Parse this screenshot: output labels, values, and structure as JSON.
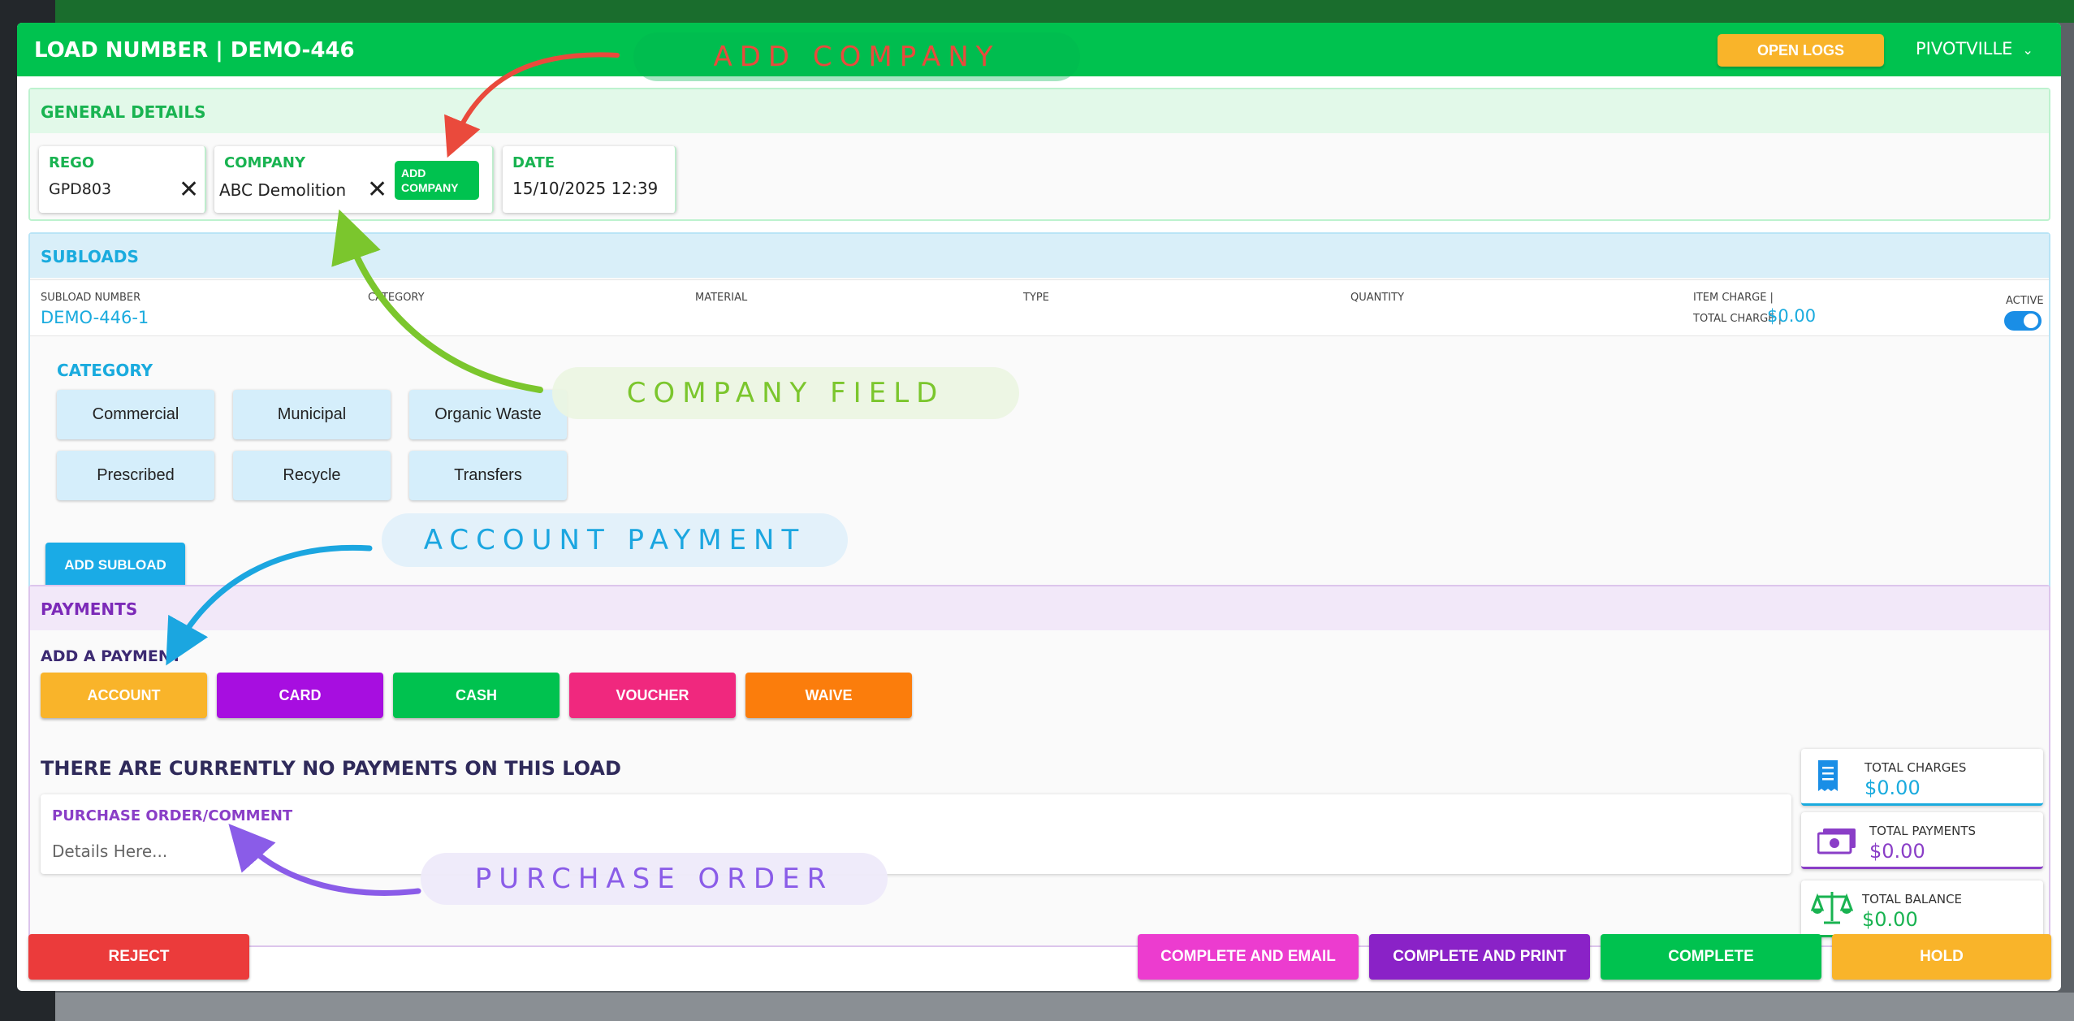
{
  "modal": {
    "title": "LOAD NUMBER | DEMO-446",
    "open_logs_label": "OPEN LOGS",
    "site_name": "PIVOTVILLE"
  },
  "general": {
    "title": "GENERAL DETAILS",
    "rego_label": "REGO",
    "rego_value": "GPD803",
    "company_label": "COMPANY",
    "company_value": "ABC Demolition",
    "add_company_line1": "ADD",
    "add_company_line2": "COMPANY",
    "date_label": "DATE",
    "date_value": "15/10/2025 12:39"
  },
  "subloads": {
    "title": "SUBLOADS",
    "columns": [
      "SUBLOAD NUMBER",
      "CATEGORY",
      "MATERIAL",
      "TYPE",
      "QUANTITY",
      "ITEM CHARGE |"
    ],
    "subload_number": "DEMO-446-1",
    "total_charge_label": "TOTAL CHARGE |",
    "total_charge_value": "$0.00",
    "active_label": "ACTIVE",
    "active": true,
    "category_title": "CATEGORY",
    "categories": [
      "Commercial",
      "Municipal",
      "Organic Waste",
      "Prescribed",
      "Recycle",
      "Transfers"
    ],
    "add_subload_label": "ADD SUBLOAD"
  },
  "payments": {
    "title": "PAYMENTS",
    "add_payment_title": "ADD A PAYMENT",
    "methods": [
      {
        "label": "ACCOUNT",
        "color": "#f9b42a"
      },
      {
        "label": "CARD",
        "color": "#a70ee0"
      },
      {
        "label": "CASH",
        "color": "#00c24f"
      },
      {
        "label": "VOUCHER",
        "color": "#f0287e"
      },
      {
        "label": "WAIVE",
        "color": "#fb7d0c"
      }
    ],
    "no_payments_text": "THERE ARE CURRENTLY NO PAYMENTS ON THIS LOAD",
    "po_label": "PURCHASE ORDER/COMMENT",
    "po_placeholder": "Details Here...",
    "totals": [
      {
        "label": "TOTAL CHARGES",
        "value": "$0.00",
        "color": "#1aabde",
        "icon": "receipt-icon"
      },
      {
        "label": "TOTAL PAYMENTS",
        "value": "$0.00",
        "color": "#8a3ec7",
        "icon": "cash-icon"
      },
      {
        "label": "TOTAL BALANCE",
        "value": "$0.00",
        "color": "#19b351",
        "icon": "scale-icon"
      }
    ]
  },
  "footer": {
    "reject_label": "REJECT",
    "complete_email_label": "COMPLETE AND EMAIL",
    "complete_print_label": "COMPLETE AND PRINT",
    "complete_label": "COMPLETE",
    "hold_label": "HOLD"
  },
  "annotations": {
    "add_company": "ADD COMPANY",
    "company_field": "COMPANY FIELD",
    "account_payment": "ACCOUNT PAYMENT",
    "purchase_order": "PURCHASE ORDER"
  }
}
